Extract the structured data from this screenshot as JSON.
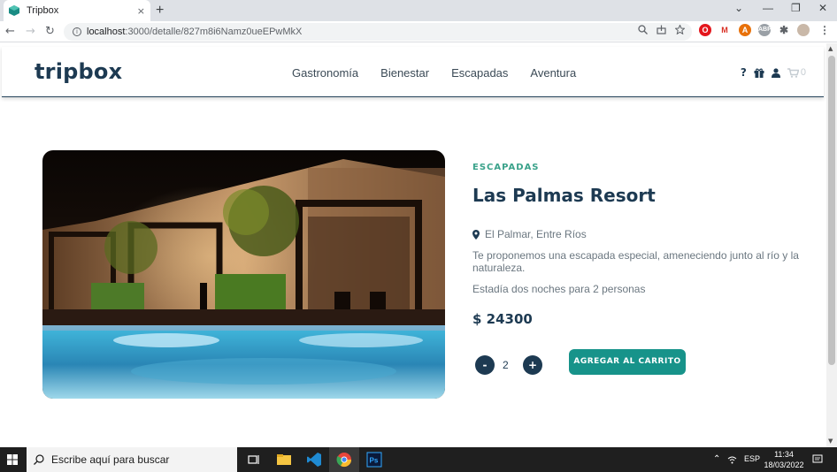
{
  "browser": {
    "tab_title": "Tripbox",
    "tab_close": "×",
    "new_tab": "+",
    "url_host": "localhost",
    "url_path": ":3000/detalle/827m8i6Namz0ueEPwMkX",
    "window_controls": [
      "⌄",
      "—",
      "❐",
      "✕"
    ]
  },
  "site": {
    "logo": "tripbox",
    "nav": [
      "Gastronomía",
      "Bienestar",
      "Escapadas",
      "Aventura"
    ],
    "cart_count": "0"
  },
  "product": {
    "category": "ESCAPADAS",
    "title": "Las Palmas Resort",
    "location": "El Palmar, Entre Ríos",
    "description": "Te proponemos una escapada especial, ameneciendo junto al río y la naturaleza.",
    "stay": "Estadía dos noches para 2 personas",
    "price": "$ 24300",
    "quantity": "2",
    "minus_label": "-",
    "plus_label": "+",
    "add_label": "AGREGAR AL CARRITO"
  },
  "taskbar": {
    "search_placeholder": "Escribe aquí para buscar",
    "lang": "ESP",
    "time": "11:34",
    "date": "18/03/2022"
  },
  "colors": {
    "brand": "#1d3a52",
    "accent": "#17938a",
    "category": "#3aa28a"
  }
}
